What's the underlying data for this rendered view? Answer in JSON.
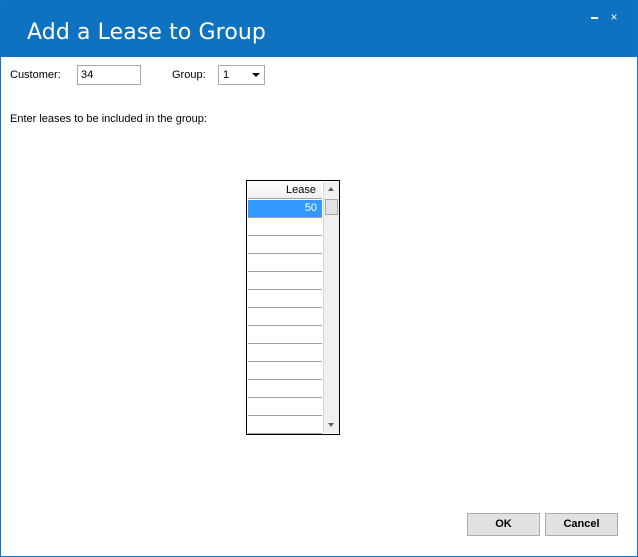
{
  "window": {
    "title": "Add a Lease to Group",
    "controls": {
      "minimize_icon": "minimize-icon",
      "close_glyph": "×"
    },
    "accent_color": "#0f72c0"
  },
  "form": {
    "customer_label": "Customer:",
    "customer_value": "34",
    "group_label": "Group:",
    "group_value": "1",
    "instruction": "Enter leases to be included in the group:"
  },
  "grid": {
    "column_header": "Lease",
    "rows": [
      "50",
      "",
      "",
      "",
      "",
      "",
      "",
      "",
      "",
      "",
      "",
      "",
      ""
    ],
    "selected_row": 0
  },
  "buttons": {
    "ok_label": "OK",
    "cancel_label": "Cancel"
  }
}
